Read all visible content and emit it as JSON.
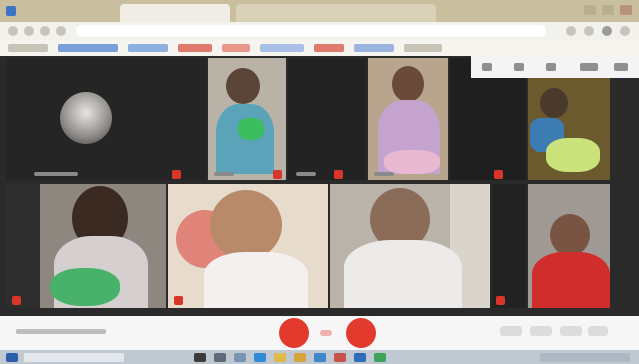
{
  "browser": {
    "tabs": [
      {
        "label": ""
      },
      {
        "label": ""
      }
    ]
  },
  "meeting": {
    "label": "",
    "participants": [
      {
        "name": ""
      },
      {
        "name": ""
      },
      {
        "name": ""
      },
      {
        "name": ""
      },
      {
        "name": ""
      },
      {
        "name": ""
      },
      {
        "name": ""
      },
      {
        "name": ""
      },
      {
        "name": ""
      },
      {
        "name": ""
      }
    ]
  },
  "colors": {
    "end_call": "#e23b2e",
    "mic_muted": "#d8362a",
    "meeting_bg": "#2a2a2a"
  },
  "icons": [
    "mic-off-icon",
    "camera-off-icon",
    "hangup-icon",
    "grid-icon",
    "chat-icon",
    "people-icon",
    "more-icon",
    "back-icon",
    "forward-icon",
    "reload-icon"
  ]
}
